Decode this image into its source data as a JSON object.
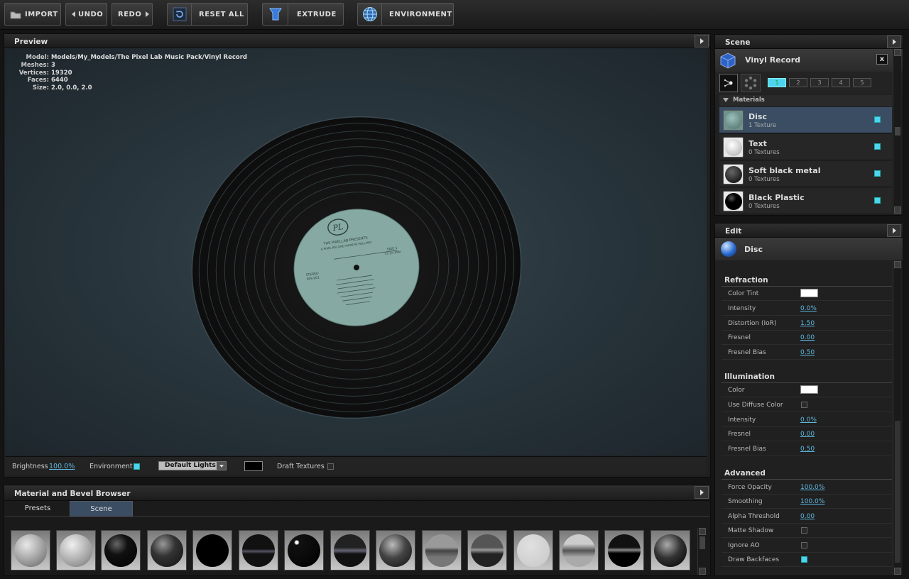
{
  "toolbar": {
    "import": "IMPORT",
    "undo": "UNDO",
    "redo": "REDO",
    "reset_all": "RESET ALL",
    "extrude": "EXTRUDE",
    "environment": "ENVIRONMENT"
  },
  "preview": {
    "title": "Preview",
    "info": [
      {
        "key": "Model:",
        "value": "Models/My_Models/The Pixel Lab Music Pack/Vinyl Record"
      },
      {
        "key": "Meshes:",
        "value": "3"
      },
      {
        "key": "Vertices:",
        "value": "19320"
      },
      {
        "key": "Faces:",
        "value": "6440"
      },
      {
        "key": "Size:",
        "value": "2.0, 0.0, 2.0"
      }
    ],
    "label": {
      "logo": "PL",
      "line1": "THE PIXELLAB PRESENTS",
      "line2": "A PIXEL RECORD MADE IN POLLAND",
      "left1": "STEREO",
      "left2": "SPS 001",
      "right1": "SIDE 1",
      "right2": "33 1/3 RPM"
    },
    "brightness_label": "Brightness",
    "brightness_value": "100.0%",
    "environment_label": "Environment",
    "lights_select": "Default Lights",
    "draft_label": "Draft Textures"
  },
  "scene": {
    "title": "Scene",
    "object_name": "Vinyl Record",
    "close": "x",
    "view_numbers": [
      "1",
      "2",
      "3",
      "4",
      "5"
    ],
    "materials_header": "Materials",
    "materials": [
      {
        "name": "Disc",
        "sub": "1 Texture"
      },
      {
        "name": "Text",
        "sub": "0 Textures"
      },
      {
        "name": "Soft black metal",
        "sub": "0 Textures"
      },
      {
        "name": "Black Plastic",
        "sub": "0 Textures"
      }
    ]
  },
  "edit": {
    "title": "Edit",
    "material_name": "Disc",
    "refraction": {
      "title": "Refraction",
      "rows": [
        {
          "label": "Color Tint",
          "value": ""
        },
        {
          "label": "Intensity",
          "value": "0.0%"
        },
        {
          "label": "Distortion (IoR)",
          "value": "1.50"
        },
        {
          "label": "Fresnel",
          "value": "0.00"
        },
        {
          "label": "Fresnel Bias",
          "value": "0.50"
        }
      ]
    },
    "illumination": {
      "title": "Illumination",
      "rows": [
        {
          "label": "Color",
          "value": ""
        },
        {
          "label": "Use Diffuse Color",
          "value": ""
        },
        {
          "label": "Intensity",
          "value": "0.0%"
        },
        {
          "label": "Fresnel",
          "value": "0.00"
        },
        {
          "label": "Fresnel Bias",
          "value": "0.50"
        }
      ]
    },
    "advanced": {
      "title": "Advanced",
      "rows": [
        {
          "label": "Force Opacity",
          "value": "100.0%"
        },
        {
          "label": "Smoothing",
          "value": "100.0%"
        },
        {
          "label": "Alpha Threshold",
          "value": "0.00"
        },
        {
          "label": "Matte Shadow",
          "value": ""
        },
        {
          "label": "Ignore AO",
          "value": ""
        },
        {
          "label": "Draw Backfaces",
          "value": ""
        }
      ]
    }
  },
  "browser": {
    "title": "Material and Bevel Browser",
    "tabs": [
      "Presets",
      "Scene"
    ]
  },
  "colors": {
    "accent": "#4fd4f0",
    "selected_row": "#3a4d62",
    "label_teal": "#86aaa3"
  }
}
